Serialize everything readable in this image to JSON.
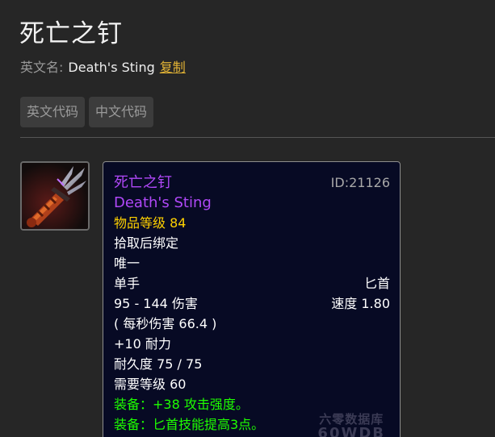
{
  "page": {
    "title": "死亡之钉",
    "english_name_label": "英文名:",
    "english_name": "Death's Sting",
    "copy_label": "复制"
  },
  "tabs": [
    {
      "label": "英文代码"
    },
    {
      "label": "中文代码"
    }
  ],
  "item": {
    "icon_name": "dagger-weapon-icon",
    "name_cn": "死亡之钉",
    "id_text": "ID:21126",
    "name_en": "Death's Sting",
    "item_level": "物品等级 84",
    "bind": "拾取后绑定",
    "unique": "唯一",
    "slot": "单手",
    "weapon_type": "匕首",
    "damage": "95 - 144 伤害",
    "speed": "速度 1.80",
    "dps": "( 每秒伤害 66.4 )",
    "stat": "+10 耐力",
    "durability": "耐久度 75 / 75",
    "required_level": "需要等级 60",
    "equip_1": "装备：+38 攻击强度。",
    "equip_2": "装备：匕首技能提高3点。",
    "colors": {
      "epic": "#b048f8",
      "gold": "#ffd100",
      "green": "#1eff00",
      "tooltip_bg": "#070a24"
    }
  },
  "watermark": {
    "line1": "六零数据库",
    "line2": "60WDB"
  }
}
